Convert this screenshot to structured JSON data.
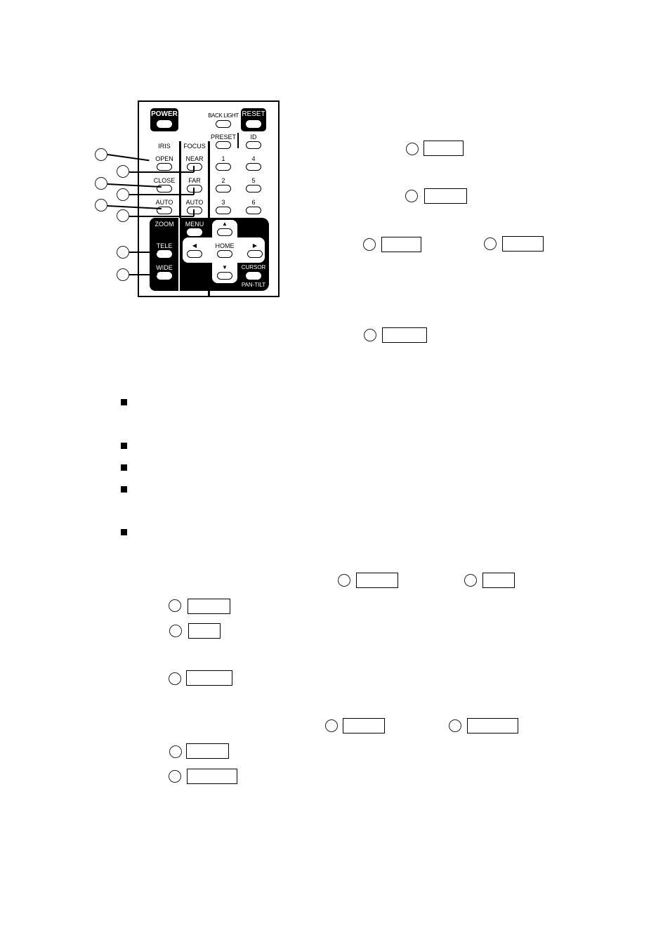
{
  "remote": {
    "power": "POWER",
    "back_light": "BACK LIGHT",
    "reset": "RESET",
    "preset": "PRESET",
    "id": "ID",
    "iris": "IRIS",
    "focus": "FOCUS",
    "open": "OPEN",
    "near": "NEAR",
    "close": "CLOSE",
    "far": "FAR",
    "iris_auto": "AUTO",
    "focus_auto": "AUTO",
    "num1": "1",
    "num2": "2",
    "num3": "3",
    "num4": "4",
    "num5": "5",
    "num6": "6",
    "zoom": "ZOOM",
    "tele": "TELE",
    "wide": "WIDE",
    "menu": "MENU",
    "home": "HOME",
    "up": "▲",
    "down": "▼",
    "left": "◀",
    "right": "▶",
    "cursor": "CURSOR",
    "pan_tilt": "PAN-TILT"
  },
  "callouts": {
    "remote_markers": [
      "",
      "",
      "",
      "",
      "",
      "",
      "",
      ""
    ],
    "boxes": [
      "",
      "",
      "",
      "",
      "",
      "",
      "",
      "",
      "",
      "",
      "",
      "",
      "",
      "",
      ""
    ]
  },
  "bullets": [
    "",
    "",
    "",
    "",
    ""
  ]
}
